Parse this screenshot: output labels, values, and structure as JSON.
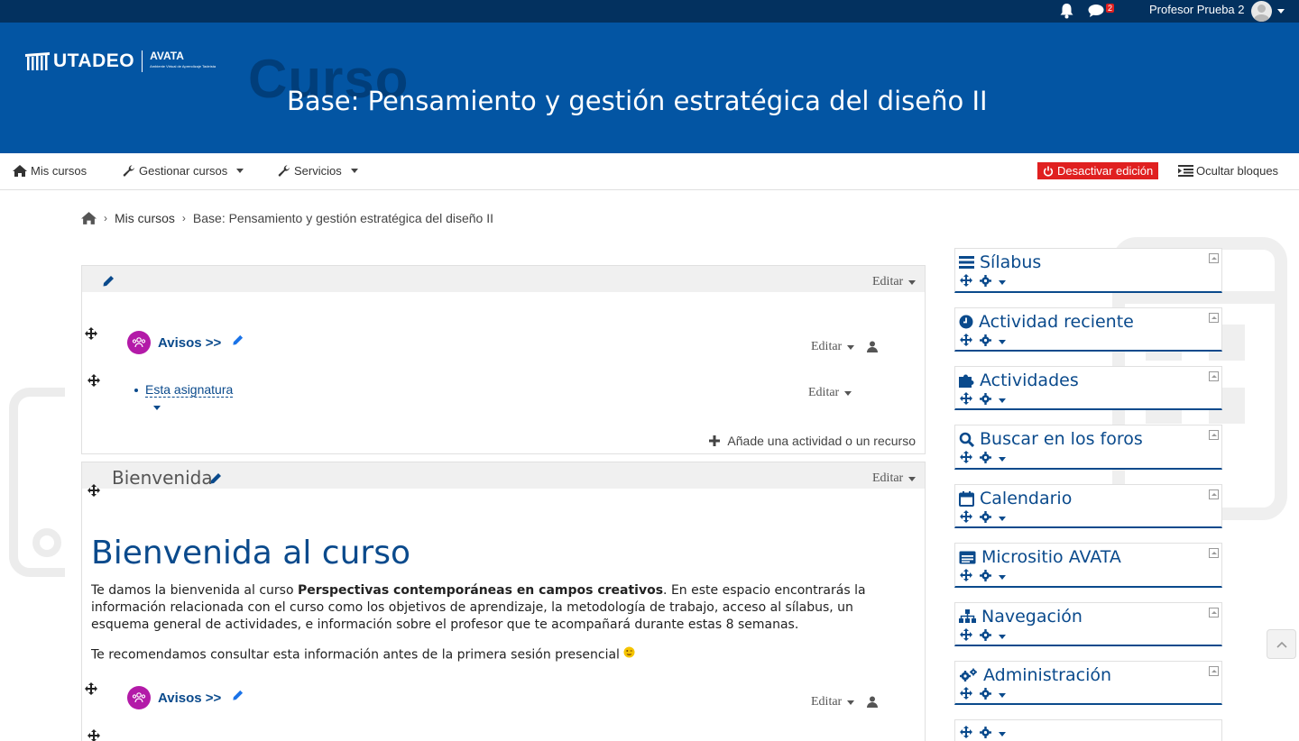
{
  "topbar": {
    "notification_count": "2",
    "user_name": "Profesor Prueba 2"
  },
  "header": {
    "logo_text": "UTADEO",
    "logo_sub": "AVATA",
    "logo_tagline": "Ambiente Virtual de Aprendizaje Tadeísta",
    "ghost_word": "Curso",
    "course_title": "Base: Pensamiento y gestión estratégica del diseño II"
  },
  "nav": {
    "my_courses": "Mis cursos",
    "manage_courses": "Gestionar cursos",
    "services": "Servicios",
    "deactivate_editing": "Desactivar edición",
    "hide_blocks": "Ocultar bloques"
  },
  "breadcrumb": {
    "items": [
      "Mis cursos",
      "Base: Pensamiento y gestión estratégica del diseño II"
    ]
  },
  "section0": {
    "edit_label": "Editar",
    "forum_label": "Avisos >>",
    "forum_edit": "Editar",
    "page_label": "Esta asignatura",
    "page_edit": "Editar",
    "add_activity": "Añade una actividad o un recurso"
  },
  "section1": {
    "title": "Bienvenida",
    "edit_label": "Editar",
    "heading": "Bienvenida al curso",
    "p1_start": "Te damos la bienvenida al curso ",
    "p1_bold": "Perspectivas contemporáneas en campos creativos",
    "p1_end": ". En este espacio encontrarás la información relacionada con el curso como los objetivos de aprendizaje, la metodología de trabajo, acceso al sílabus, un esquema general de actividades, e información sobre el profesor que te acompañará durante estas 8 semanas.",
    "p2": "Te recomendamos consultar esta información antes de la primera sesión presencial",
    "forum_label": "Avisos >>",
    "forum_edit": "Editar"
  },
  "blocks": [
    {
      "title": "Sílabus",
      "icon": "list-icon"
    },
    {
      "title": "Actividad reciente",
      "icon": "clock-icon"
    },
    {
      "title": "Actividades",
      "icon": "puzzle-icon"
    },
    {
      "title": "Buscar en los foros",
      "icon": "search-icon"
    },
    {
      "title": "Calendario",
      "icon": "calendar-icon"
    },
    {
      "title": "Micrositio AVATA",
      "icon": "window-icon"
    },
    {
      "title": "Navegación",
      "icon": "sitemap-icon"
    },
    {
      "title": "Administración",
      "icon": "cogs-icon"
    }
  ],
  "colors": {
    "topbar": "#03315f",
    "header": "#0355a3",
    "accent": "#0a4a8c",
    "danger": "#e02020",
    "forum": "#b31aa8"
  }
}
